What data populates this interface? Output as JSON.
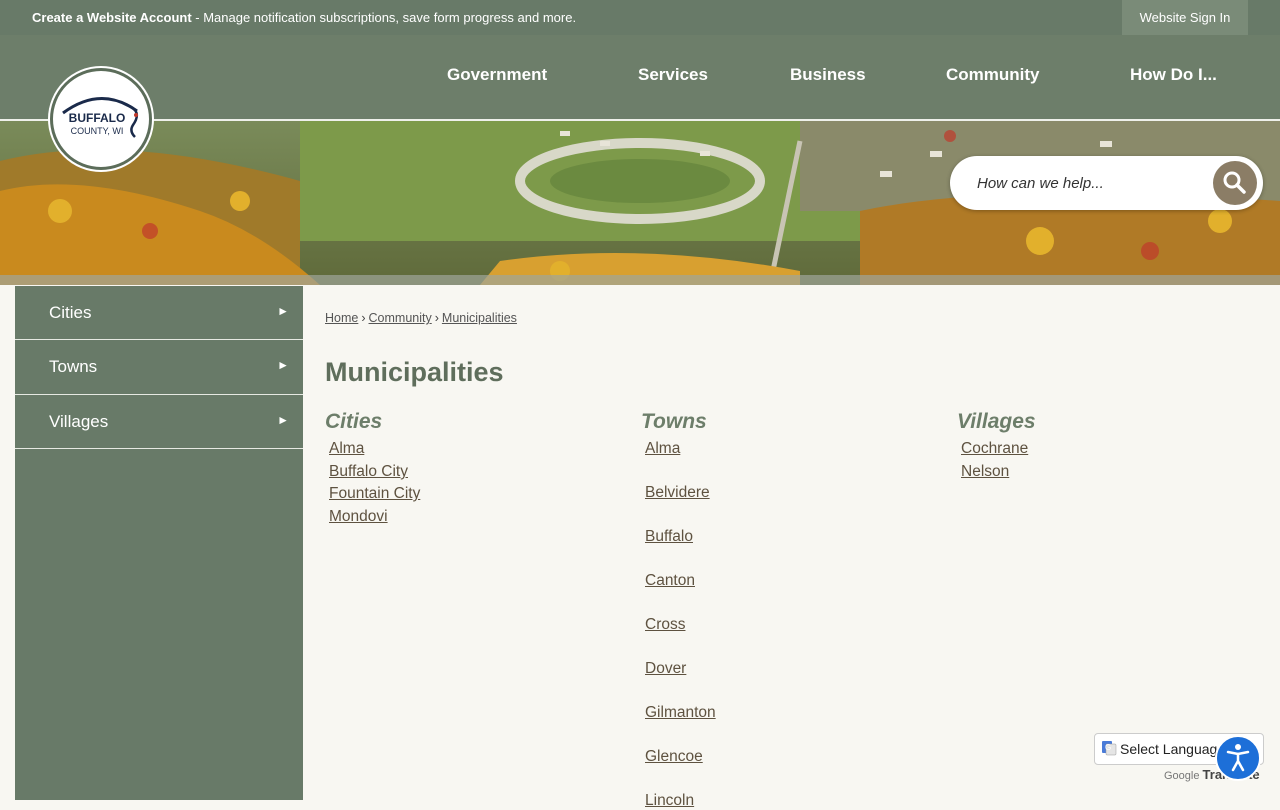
{
  "topbar": {
    "account_title": "Create a Website Account",
    "account_desc": " - Manage notification subscriptions, save form progress and more.",
    "sign_in": "Website Sign In"
  },
  "logo": {
    "line1": "BUFFALO",
    "line2": "COUNTY, WI"
  },
  "nav": [
    "Government",
    "Services",
    "Business",
    "Community",
    "How Do I..."
  ],
  "search": {
    "placeholder": "How can we help..."
  },
  "sidebar": {
    "items": [
      {
        "label": "Cities"
      },
      {
        "label": "Towns"
      },
      {
        "label": "Villages"
      }
    ],
    "arrow": "►"
  },
  "breadcrumb": [
    "Home",
    "Community",
    "Municipalities"
  ],
  "breadcrumb_sep": "›",
  "page_title": "Municipalities",
  "columns": [
    {
      "heading": "Cities",
      "links": [
        "Alma",
        "Buffalo City",
        "Fountain City",
        "Mondovi"
      ]
    },
    {
      "heading": "Towns",
      "links": [
        "Alma",
        "Belvidere",
        "Buffalo",
        "Canton",
        "Cross",
        "Dover",
        "Gilmanton",
        "Glencoe",
        "Lincoln"
      ]
    },
    {
      "heading": "Villages",
      "links": [
        "Cochrane",
        "Nelson"
      ]
    }
  ],
  "translate": {
    "label": "Select Language",
    "powered_prefix": "Google",
    "powered_word": "Translate"
  },
  "colors": {
    "topbar": "#687a68",
    "nav": "#6d7e6a",
    "sidebar": "#687a68",
    "accent": "#8b7d66",
    "link": "#5e5240"
  }
}
